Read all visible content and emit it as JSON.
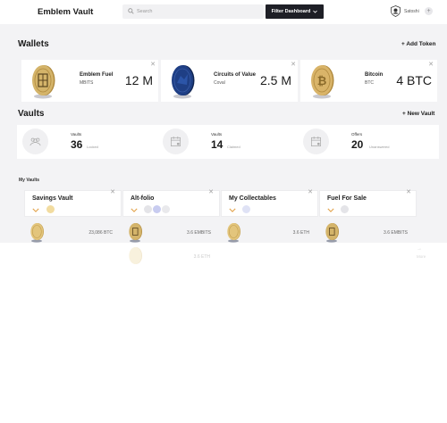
{
  "header": {
    "logo": "Emblem Vault",
    "search_placeholder": "Search",
    "filter_label": "Filter Dashboard",
    "user_name": "Satoshi",
    "plus_symbol": "+"
  },
  "wallets": {
    "title": "Wallets",
    "add_label": "+ Add Token",
    "items": [
      {
        "name": "Emblem Fuel",
        "symbol": "MBITS",
        "value": "12 M",
        "coin_color": "#d4b46a",
        "coin_icon": "emblem-coin-icon"
      },
      {
        "name": "Circuits of Value",
        "symbol": "Coval",
        "value": "2.5 M",
        "coin_color": "#1f3f85",
        "coin_icon": "coval-coin-icon"
      },
      {
        "name": "Bitcoin",
        "symbol": "BTC",
        "value": "4 BTC",
        "coin_color": "#d9b469",
        "coin_icon": "bitcoin-coin-icon"
      }
    ]
  },
  "vaults": {
    "title": "Vaults",
    "add_label": "+ New Vault",
    "stats": [
      {
        "label": "Vaults",
        "value": "36",
        "state": "Locked",
        "icon": "people-icon"
      },
      {
        "label": "Vaults",
        "value": "14",
        "state": "Claimed",
        "icon": "calendar-icon"
      },
      {
        "label": "Offers",
        "value": "20",
        "state": "Unanswered",
        "icon": "calendar-icon"
      }
    ],
    "my_vaults_label": "My Vaults",
    "cards": [
      {
        "title": "Savings Vault",
        "amount": "23,086 BTC"
      },
      {
        "title": "Alt-folio",
        "amount": "3.6 EMBITS",
        "ghost_amount": "3.6 ETH"
      },
      {
        "title": "My Collectables",
        "amount": "3.6 ETH"
      },
      {
        "title": "Fuel For Sale",
        "amount": "3.6 EMBITS"
      }
    ],
    "more_label": "More"
  },
  "colors": {
    "accent_dark": "#1e1f26",
    "gold": "#d4b46a",
    "chevron": "#e2a24a",
    "page_bg": "#f3f3f5"
  }
}
